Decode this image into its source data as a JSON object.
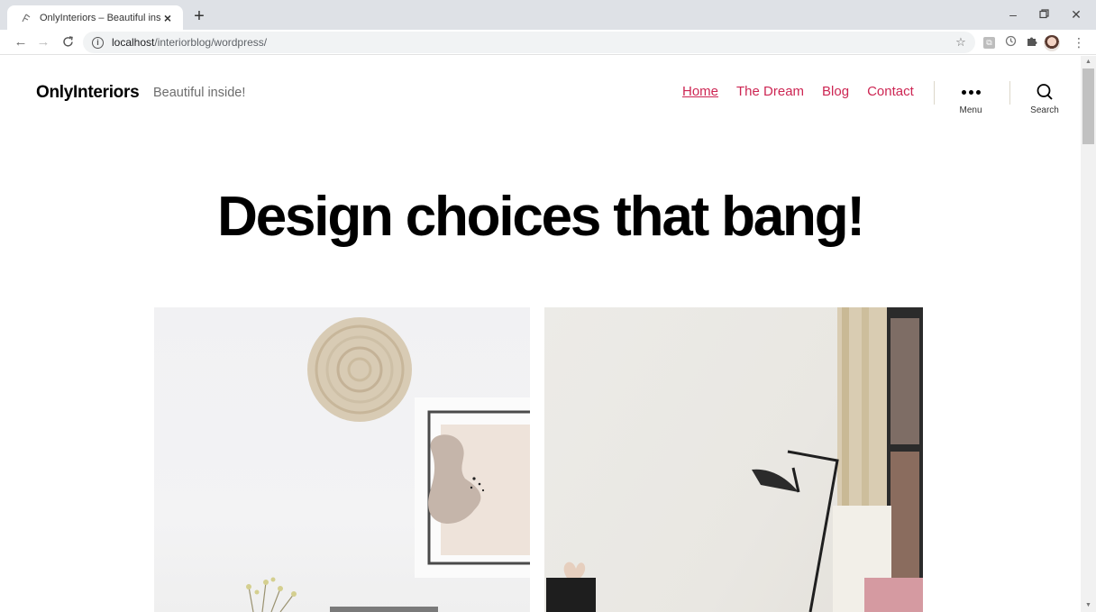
{
  "browser": {
    "tab_title": "OnlyInteriors – Beautiful inside!",
    "url_host": "localhost",
    "url_path": "/interiorblog/wordpress/"
  },
  "site": {
    "title": "OnlyInteriors",
    "description": "Beautiful inside!"
  },
  "nav": {
    "items": [
      {
        "label": "Home",
        "current": true
      },
      {
        "label": "The Dream"
      },
      {
        "label": "Blog"
      },
      {
        "label": "Contact"
      }
    ],
    "menu_label": "Menu",
    "search_label": "Search"
  },
  "page": {
    "title": "Design choices that bang!"
  },
  "colors": {
    "accent": "#cd2653",
    "text": "#000000",
    "muted": "#6d6d6d"
  },
  "icons": {
    "menu": "ellipsis-icon",
    "search": "magnifier-icon"
  }
}
